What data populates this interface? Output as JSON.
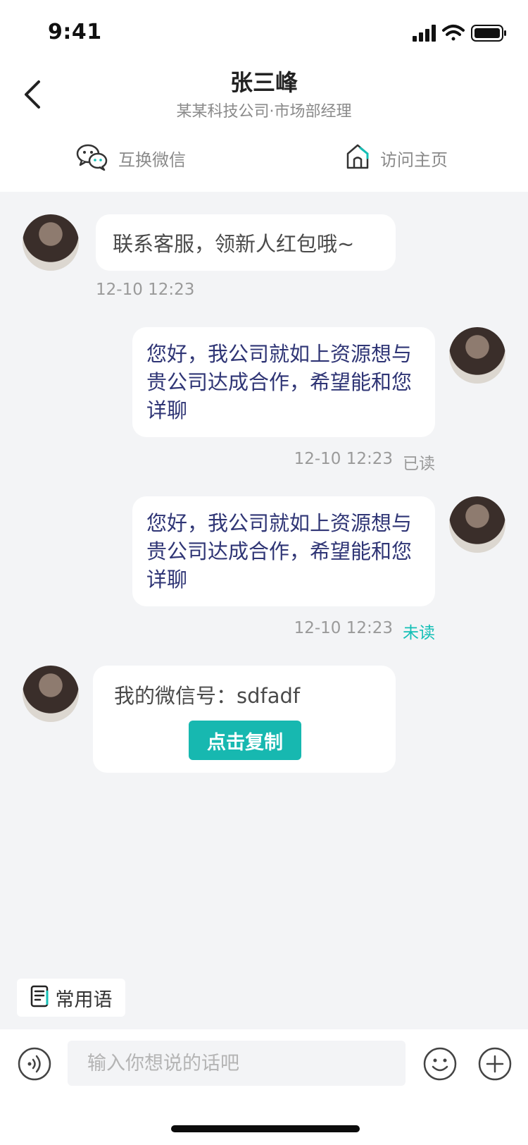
{
  "status_bar": {
    "time": "9:41"
  },
  "header": {
    "contact_name": "张三峰",
    "contact_subtitle": "某某科技公司·市场部经理",
    "actions": [
      {
        "label": "互换微信",
        "icon": "wechat-icon"
      },
      {
        "label": "访问主页",
        "icon": "home-icon"
      }
    ]
  },
  "messages": [
    {
      "side": "left",
      "text": "联系客服，领新人红包哦~",
      "time": "12-10 12:23"
    },
    {
      "side": "right",
      "text": "您好，我公司就如上资源想与贵公司达成合作，希望能和您详聊",
      "time": "12-10 12:23",
      "status": "已读"
    },
    {
      "side": "right",
      "text": "您好，我公司就如上资源想与贵公司达成合作，希望能和您详聊",
      "time": "12-10 12:23",
      "status": "未读"
    },
    {
      "side": "left",
      "type": "wechat_card",
      "text": "我的微信号：sdfadf",
      "button_label": "点击复制"
    }
  ],
  "footer": {
    "phrases_label": "常用语",
    "input_placeholder": "输入你想说的话吧"
  },
  "colors": {
    "accent_teal": "#17b8b0",
    "sent_text": "#2f3575",
    "background": "#f3f4f6"
  }
}
